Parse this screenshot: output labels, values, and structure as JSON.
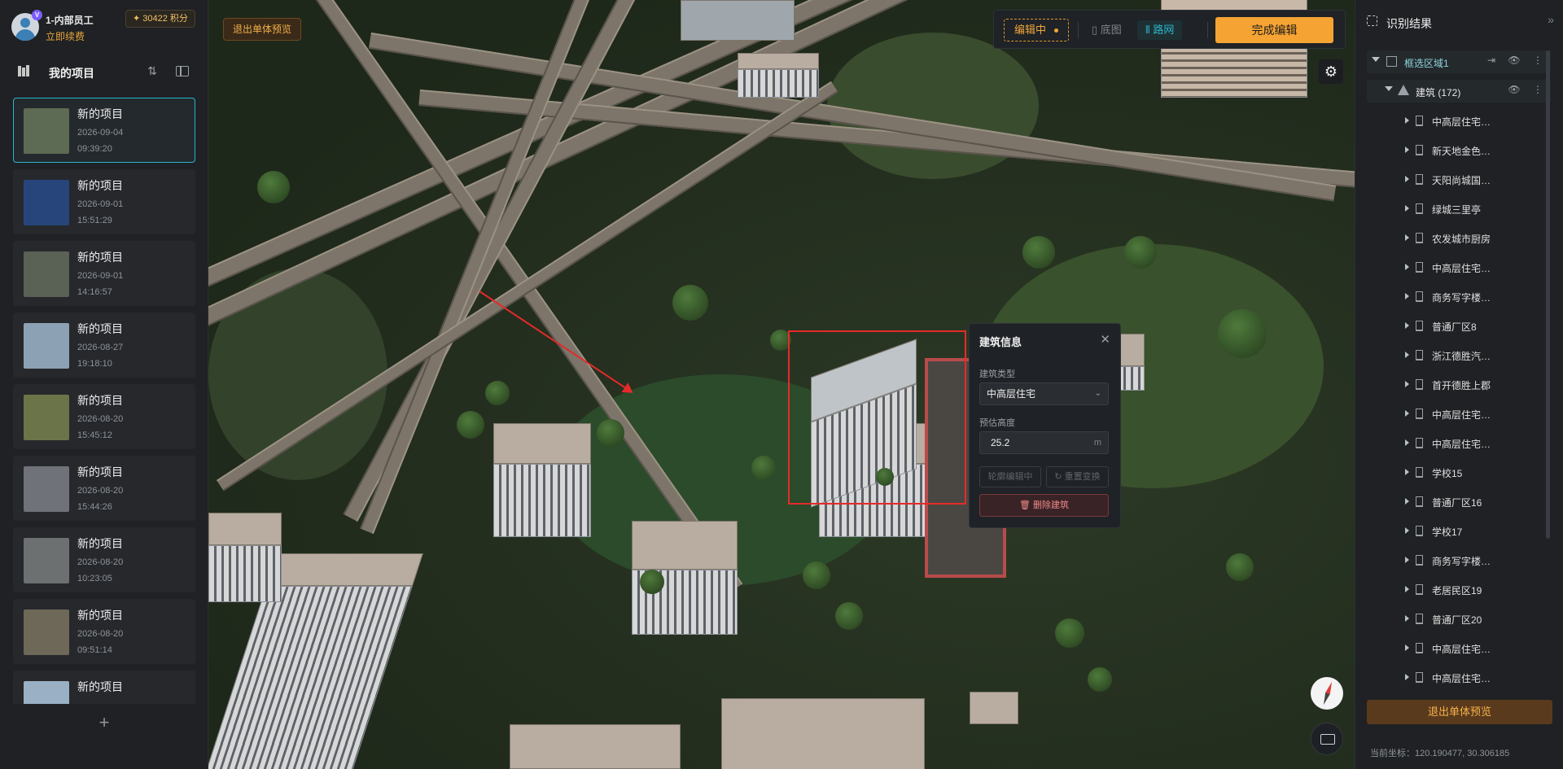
{
  "user": {
    "name": "1-内部员工",
    "renew": "立即续费",
    "vip_badge": "V",
    "points": "✦ 30422 积分"
  },
  "projects_panel": {
    "title": "我的项目",
    "sort_icon": "sort-icon",
    "items": [
      {
        "name": "新的项目",
        "date": "2026-09-04",
        "time": "09:39:20",
        "active": true,
        "thumb_color": "#5d6a54"
      },
      {
        "name": "新的项目",
        "date": "2026-09-01",
        "time": "15:51:29",
        "thumb_color": "#27457a"
      },
      {
        "name": "新的项目",
        "date": "2026-09-01",
        "time": "14:16:57",
        "thumb_color": "#5a6155"
      },
      {
        "name": "新的项目",
        "date": "2026-08-27",
        "time": "19:18:10",
        "thumb_color": "#8da1b4"
      },
      {
        "name": "新的项目",
        "date": "2026-08-20",
        "time": "15:45:12",
        "thumb_color": "#6a7448"
      },
      {
        "name": "新的项目",
        "date": "2026-08-20",
        "time": "15:44:26",
        "thumb_color": "#6f7278"
      },
      {
        "name": "新的项目",
        "date": "2026-08-20",
        "time": "10:23:05",
        "thumb_color": "#6c7070"
      },
      {
        "name": "新的项目",
        "date": "2026-08-20",
        "time": "09:51:14",
        "thumb_color": "#6e6858"
      },
      {
        "name": "新的项目",
        "date": "",
        "time": "",
        "thumb_color": "#9ab0c4"
      }
    ],
    "add_label": "+"
  },
  "map": {
    "exit_preview_tag": "退出单体预览",
    "toolbar": {
      "editing": "编辑中",
      "base_map": "底图",
      "road_net": "路网",
      "finish": "完成编辑"
    },
    "settings_icon": "gear-icon",
    "compass_icon": "compass-icon",
    "keyboard_icon": "keyboard-icon"
  },
  "building_info": {
    "title": "建筑信息",
    "type_label": "建筑类型",
    "type_value": "中高层住宅",
    "height_label": "预估高度",
    "height_value": "25.2",
    "height_unit": "m",
    "outline_edit": "轮廓编辑中",
    "reset_transform": "重置变换",
    "delete": "删除建筑"
  },
  "results": {
    "title": "识别结果",
    "region": "框选区域1",
    "category": "建筑 (172)",
    "buildings": [
      "中高层住宅…",
      "新天地金色…",
      "天阳尚城国…",
      "绿城三里亭",
      "农发城市厨房",
      "中高层住宅…",
      "商务写字楼…",
      "普通厂区8",
      "浙江德胜汽…",
      "首开德胜上郡",
      "中高层住宅…",
      "中高层住宅…",
      "学校15",
      "普通厂区16",
      "学校17",
      "商务写字楼…",
      "老居民区19",
      "普通厂区20",
      "中高层住宅…",
      "中高层住宅…"
    ],
    "exit_button": "退出单体预览",
    "coords": "当前坐标：120.190477, 30.306185"
  }
}
